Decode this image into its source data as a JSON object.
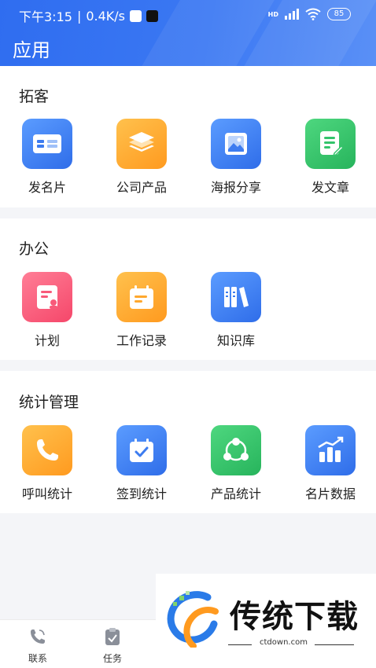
{
  "status_bar": {
    "time": "下午3:15",
    "speed": "0.4K/s",
    "network": "HD",
    "battery": "85"
  },
  "header": {
    "title": "应用"
  },
  "sections": [
    {
      "title": "拓客",
      "items": [
        {
          "label": "发名片",
          "icon": "business-card-icon",
          "color": "#3d7cf0"
        },
        {
          "label": "公司产品",
          "icon": "layers-icon",
          "color": "#ffa82e"
        },
        {
          "label": "海报分享",
          "icon": "image-icon",
          "color": "#3d7cf0"
        },
        {
          "label": "发文章",
          "icon": "edit-document-icon",
          "color": "#33c46b"
        }
      ]
    },
    {
      "title": "办公",
      "items": [
        {
          "label": "计划",
          "icon": "plan-icon",
          "color": "#f85a7a"
        },
        {
          "label": "工作记录",
          "icon": "calendar-note-icon",
          "color": "#ffa82e"
        },
        {
          "label": "知识库",
          "icon": "books-icon",
          "color": "#3d7cf0"
        }
      ]
    },
    {
      "title": "统计管理",
      "items": [
        {
          "label": "呼叫统计",
          "icon": "phone-icon",
          "color": "#ffa82e"
        },
        {
          "label": "签到统计",
          "icon": "calendar-check-icon",
          "color": "#3d7cf0"
        },
        {
          "label": "产品统计",
          "icon": "share-icon",
          "color": "#33c46b"
        },
        {
          "label": "名片数据",
          "icon": "bar-chart-icon",
          "color": "#3d7cf0"
        }
      ]
    }
  ],
  "tabbar": [
    {
      "label": "联系",
      "icon": "phone-contact-icon"
    },
    {
      "label": "任务",
      "icon": "clipboard-icon"
    }
  ],
  "watermark": {
    "brand": "传统下载",
    "url": "ctdown.com"
  }
}
